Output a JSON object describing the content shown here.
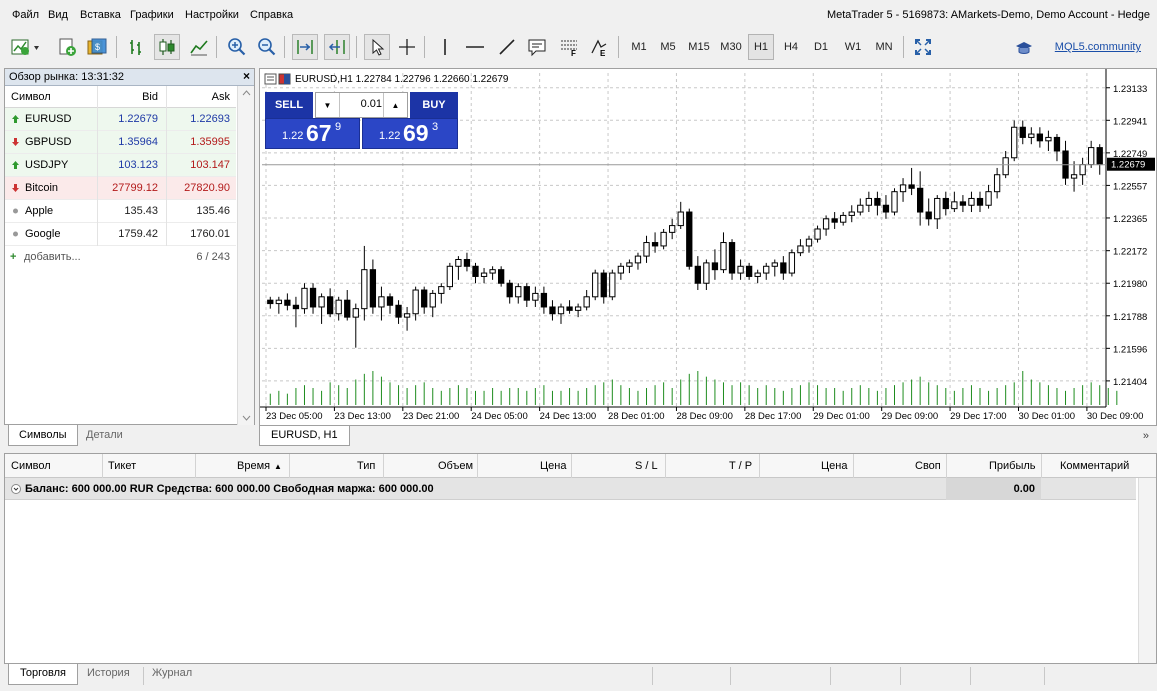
{
  "menu": {
    "items": [
      "Файл",
      "Вид",
      "Вставка",
      "Графики",
      "Настройки",
      "Справка"
    ],
    "window_title": "MetaTrader 5 - 5169873: AMarkets-Demo, Demo Account - Hedge"
  },
  "toolbar": {
    "timeframes": [
      "M1",
      "M5",
      "M15",
      "M30",
      "H1",
      "H4",
      "D1",
      "W1",
      "MN"
    ],
    "active_timeframe": "H1",
    "community_link": "MQL5.community"
  },
  "market_watch": {
    "title": "Обзор рынка: 13:31:32",
    "columns": {
      "symbol": "Символ",
      "bid": "Bid",
      "ask": "Ask"
    },
    "rows": [
      {
        "symbol": "EURUSD",
        "bid": "1.22679",
        "ask": "1.22693",
        "direction": "up"
      },
      {
        "symbol": "GBPUSD",
        "bid": "1.35964",
        "ask": "1.35995",
        "direction": "down"
      },
      {
        "symbol": "USDJPY",
        "bid": "103.123",
        "ask": "103.147",
        "direction": "up"
      },
      {
        "symbol": "Bitcoin",
        "bid": "27799.12",
        "ask": "27820.90",
        "direction": "down"
      },
      {
        "symbol": "Apple",
        "bid": "135.43",
        "ask": "135.46",
        "direction": "none"
      },
      {
        "symbol": "Google",
        "bid": "1759.42",
        "ask": "1760.01",
        "direction": "none"
      }
    ],
    "add_label": "добавить...",
    "count": "6 / 243",
    "tabs": [
      "Символы",
      "Детали"
    ],
    "active_tab": "Символы"
  },
  "chart": {
    "header": "EURUSD,H1  1.22784 1.22796 1.22660 1.22679",
    "tab_label": "EURUSD, H1",
    "one_click": {
      "sell_label": "SELL",
      "buy_label": "BUY",
      "lot": "0.01",
      "sell_price_prefix": "1.22",
      "sell_price_big": "67",
      "sell_price_sup": "9",
      "buy_price_prefix": "1.22",
      "buy_price_big": "69",
      "buy_price_sup": "3"
    },
    "more_icon": "»"
  },
  "chart_data": {
    "type": "candlestick",
    "symbol": "EURUSD",
    "timeframe": "H1",
    "y_ticks": [
      "1.23133",
      "1.22941",
      "1.22749",
      "1.22557",
      "1.22365",
      "1.22172",
      "1.21980",
      "1.21788",
      "1.21596",
      "1.21404"
    ],
    "ylim": [
      1.2125,
      1.2322
    ],
    "x_ticks": [
      "23 Dec 05:00",
      "23 Dec 13:00",
      "23 Dec 21:00",
      "24 Dec 05:00",
      "24 Dec 13:00",
      "28 Dec 01:00",
      "28 Dec 09:00",
      "28 Dec 17:00",
      "29 Dec 01:00",
      "29 Dec 09:00",
      "29 Dec 17:00",
      "30 Dec 01:00",
      "30 Dec 09:00"
    ],
    "current_price": "1.22679",
    "candles": [
      [
        1.2188,
        1.219,
        1.2183,
        1.2186
      ],
      [
        1.2186,
        1.219,
        1.218,
        1.2188
      ],
      [
        1.2188,
        1.2192,
        1.2182,
        1.2185
      ],
      [
        1.2185,
        1.219,
        1.2172,
        1.2183
      ],
      [
        1.2183,
        1.2198,
        1.218,
        1.2195
      ],
      [
        1.2195,
        1.2198,
        1.218,
        1.2184
      ],
      [
        1.2184,
        1.2192,
        1.2174,
        1.219
      ],
      [
        1.219,
        1.2195,
        1.2178,
        1.218
      ],
      [
        1.218,
        1.219,
        1.2176,
        1.2188
      ],
      [
        1.2188,
        1.2194,
        1.2176,
        1.2178
      ],
      [
        1.2178,
        1.2186,
        1.216,
        1.2183
      ],
      [
        1.2183,
        1.222,
        1.2176,
        1.2206
      ],
      [
        1.2206,
        1.2212,
        1.218,
        1.2184
      ],
      [
        1.2184,
        1.2196,
        1.2176,
        1.219
      ],
      [
        1.219,
        1.2192,
        1.218,
        1.2185
      ],
      [
        1.2185,
        1.2188,
        1.2174,
        1.2178
      ],
      [
        1.2178,
        1.2184,
        1.217,
        1.218
      ],
      [
        1.218,
        1.2196,
        1.2176,
        1.2194
      ],
      [
        1.2194,
        1.2196,
        1.218,
        1.2184
      ],
      [
        1.2184,
        1.2194,
        1.2178,
        1.2192
      ],
      [
        1.2192,
        1.2198,
        1.2186,
        1.2196
      ],
      [
        1.2196,
        1.221,
        1.2194,
        1.2208
      ],
      [
        1.2208,
        1.2214,
        1.22,
        1.2212
      ],
      [
        1.2212,
        1.2216,
        1.2205,
        1.2208
      ],
      [
        1.2208,
        1.221,
        1.2198,
        1.2202
      ],
      [
        1.2202,
        1.2207,
        1.2198,
        1.2204
      ],
      [
        1.2204,
        1.2208,
        1.22,
        1.2206
      ],
      [
        1.2206,
        1.2208,
        1.2196,
        1.2198
      ],
      [
        1.2198,
        1.22,
        1.2186,
        1.219
      ],
      [
        1.219,
        1.2198,
        1.2186,
        1.2196
      ],
      [
        1.2196,
        1.2198,
        1.2184,
        1.2188
      ],
      [
        1.2188,
        1.2196,
        1.2184,
        1.2192
      ],
      [
        1.2192,
        1.2196,
        1.218,
        1.2184
      ],
      [
        1.2184,
        1.2188,
        1.2176,
        1.218
      ],
      [
        1.218,
        1.2186,
        1.2174,
        1.2184
      ],
      [
        1.2184,
        1.2188,
        1.218,
        1.2182
      ],
      [
        1.2182,
        1.2186,
        1.2178,
        1.2184
      ],
      [
        1.2184,
        1.2194,
        1.2182,
        1.219
      ],
      [
        1.219,
        1.2206,
        1.2188,
        1.2204
      ],
      [
        1.2204,
        1.2206,
        1.2186,
        1.219
      ],
      [
        1.219,
        1.2206,
        1.2188,
        1.2204
      ],
      [
        1.2204,
        1.221,
        1.22,
        1.2208
      ],
      [
        1.2208,
        1.2212,
        1.2204,
        1.221
      ],
      [
        1.221,
        1.2216,
        1.2206,
        1.2214
      ],
      [
        1.2214,
        1.2226,
        1.221,
        1.2222
      ],
      [
        1.2222,
        1.2228,
        1.2216,
        1.222
      ],
      [
        1.222,
        1.223,
        1.2218,
        1.2228
      ],
      [
        1.2228,
        1.2236,
        1.2224,
        1.2232
      ],
      [
        1.2232,
        1.2246,
        1.223,
        1.224
      ],
      [
        1.224,
        1.2242,
        1.2206,
        1.2208
      ],
      [
        1.2208,
        1.2214,
        1.2194,
        1.2198
      ],
      [
        1.2198,
        1.2212,
        1.2194,
        1.221
      ],
      [
        1.221,
        1.2218,
        1.22,
        1.2206
      ],
      [
        1.2206,
        1.2228,
        1.2204,
        1.2222
      ],
      [
        1.2222,
        1.2224,
        1.22,
        1.2204
      ],
      [
        1.2204,
        1.2212,
        1.22,
        1.2208
      ],
      [
        1.2208,
        1.221,
        1.22,
        1.2202
      ],
      [
        1.2202,
        1.2206,
        1.2198,
        1.2204
      ],
      [
        1.2204,
        1.221,
        1.22,
        1.2208
      ],
      [
        1.2208,
        1.2212,
        1.2202,
        1.221
      ],
      [
        1.221,
        1.2214,
        1.22,
        1.2204
      ],
      [
        1.2204,
        1.2218,
        1.2202,
        1.2216
      ],
      [
        1.2216,
        1.2224,
        1.2214,
        1.222
      ],
      [
        1.222,
        1.2226,
        1.2216,
        1.2224
      ],
      [
        1.2224,
        1.2232,
        1.2222,
        1.223
      ],
      [
        1.223,
        1.2238,
        1.2226,
        1.2236
      ],
      [
        1.2236,
        1.224,
        1.223,
        1.2234
      ],
      [
        1.2234,
        1.224,
        1.2232,
        1.2238
      ],
      [
        1.2238,
        1.2244,
        1.2234,
        1.224
      ],
      [
        1.224,
        1.2248,
        1.2238,
        1.2244
      ],
      [
        1.2244,
        1.2252,
        1.224,
        1.2248
      ],
      [
        1.2248,
        1.2252,
        1.2238,
        1.2244
      ],
      [
        1.2244,
        1.225,
        1.2236,
        1.224
      ],
      [
        1.224,
        1.2254,
        1.2238,
        1.2252
      ],
      [
        1.2252,
        1.226,
        1.2246,
        1.2256
      ],
      [
        1.2256,
        1.2266,
        1.225,
        1.2254
      ],
      [
        1.2254,
        1.2264,
        1.2232,
        1.224
      ],
      [
        1.224,
        1.2248,
        1.2232,
        1.2236
      ],
      [
        1.2236,
        1.225,
        1.223,
        1.2248
      ],
      [
        1.2248,
        1.2252,
        1.2238,
        1.2242
      ],
      [
        1.2242,
        1.2252,
        1.224,
        1.2246
      ],
      [
        1.2246,
        1.225,
        1.224,
        1.2244
      ],
      [
        1.2244,
        1.2252,
        1.224,
        1.2248
      ],
      [
        1.2248,
        1.2252,
        1.224,
        1.2244
      ],
      [
        1.2244,
        1.2256,
        1.2242,
        1.2252
      ],
      [
        1.2252,
        1.2266,
        1.2248,
        1.2262
      ],
      [
        1.2262,
        1.2276,
        1.226,
        1.2272
      ],
      [
        1.2272,
        1.2294,
        1.227,
        1.229
      ],
      [
        1.229,
        1.2294,
        1.228,
        1.2284
      ],
      [
        1.2284,
        1.229,
        1.228,
        1.2286
      ],
      [
        1.2286,
        1.229,
        1.2278,
        1.2282
      ],
      [
        1.2282,
        1.2288,
        1.2276,
        1.2284
      ],
      [
        1.2284,
        1.2286,
        1.227,
        1.2276
      ],
      [
        1.2276,
        1.2282,
        1.2256,
        1.226
      ],
      [
        1.226,
        1.227,
        1.2252,
        1.2262
      ],
      [
        1.2262,
        1.2272,
        1.2256,
        1.2268
      ],
      [
        1.2268,
        1.2282,
        1.2266,
        1.2278
      ],
      [
        1.2278,
        1.228,
        1.2262,
        1.2268
      ]
    ],
    "volumes": [
      4,
      5,
      4,
      6,
      7,
      6,
      5,
      8,
      7,
      6,
      9,
      11,
      12,
      10,
      8,
      7,
      6,
      7,
      8,
      6,
      5,
      6,
      7,
      6,
      5,
      5,
      6,
      5,
      6,
      6,
      5,
      6,
      7,
      5,
      5,
      6,
      5,
      6,
      7,
      8,
      9,
      7,
      6,
      5,
      6,
      7,
      8,
      6,
      9,
      11,
      12,
      10,
      9,
      8,
      7,
      8,
      7,
      6,
      7,
      6,
      5,
      6,
      7,
      8,
      7,
      6,
      6,
      5,
      6,
      7,
      6,
      5,
      6,
      7,
      8,
      9,
      10,
      8,
      7,
      6,
      5,
      6,
      7,
      6,
      5,
      6,
      7,
      8,
      12,
      9,
      8,
      7,
      6,
      5,
      6,
      7,
      8,
      7,
      6,
      5
    ]
  },
  "trade_panel": {
    "columns": [
      "Символ",
      "Тикет",
      "Время",
      "Тип",
      "Объем",
      "Цена",
      "S / L",
      "T / P",
      "Цена",
      "Своп",
      "Прибыль",
      "Комментарий"
    ],
    "balance_line": "Баланс: 600 000.00 RUR  Средства: 600 000.00  Свободная маржа: 600 000.00",
    "balance_profit": "0.00",
    "tabs": [
      "Торговля",
      "История",
      "Журнал"
    ],
    "active_tab": "Торговля"
  },
  "colors": {
    "bid_up": "#1f3aa6",
    "ask_down": "#b31b1b",
    "accent_blue": "#1c34a6",
    "volume_green": "#1e8c1e"
  }
}
